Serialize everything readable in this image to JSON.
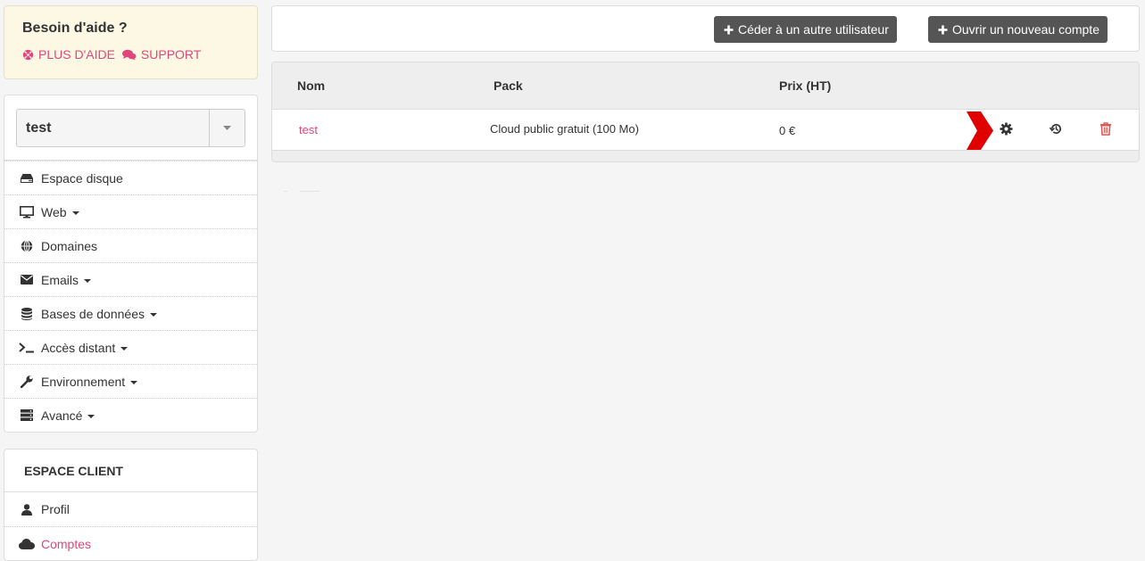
{
  "help": {
    "title": "Besoin d'aide ?",
    "more_help": "PLUS D'AIDE",
    "support": "SUPPORT"
  },
  "account_select": {
    "value": "test"
  },
  "nav": {
    "items": [
      {
        "label": "Espace disque",
        "icon": "hdd-icon",
        "dropdown": false
      },
      {
        "label": "Web",
        "icon": "monitor-icon",
        "dropdown": true
      },
      {
        "label": "Domaines",
        "icon": "globe-icon",
        "dropdown": false
      },
      {
        "label": "Emails",
        "icon": "envelope-icon",
        "dropdown": true
      },
      {
        "label": "Bases de données",
        "icon": "database-icon",
        "dropdown": true
      },
      {
        "label": "Accès distant",
        "icon": "terminal-icon",
        "dropdown": true
      },
      {
        "label": "Environnement",
        "icon": "wrench-icon",
        "dropdown": true
      },
      {
        "label": "Avancé",
        "icon": "server-icon",
        "dropdown": true
      }
    ]
  },
  "client": {
    "title": "ESPACE CLIENT",
    "items": [
      {
        "label": "Profil",
        "icon": "user-icon"
      },
      {
        "label": "Comptes",
        "icon": "cloud-icon"
      }
    ]
  },
  "toolbar": {
    "transfer_label": "Céder à un autre utilisateur",
    "open_label": "Ouvrir un nouveau compte"
  },
  "table": {
    "headers": {
      "name": "Nom",
      "pack": "Pack",
      "price": "Prix (HT)"
    },
    "rows": [
      {
        "name": "test",
        "pack": "Cloud public gratuit (100 Mo)",
        "price": "0 €"
      }
    ]
  },
  "colors": {
    "accent": "#e0467c",
    "button_bg": "#555555",
    "delete": "#d9534f",
    "pointer": "#e00000"
  }
}
